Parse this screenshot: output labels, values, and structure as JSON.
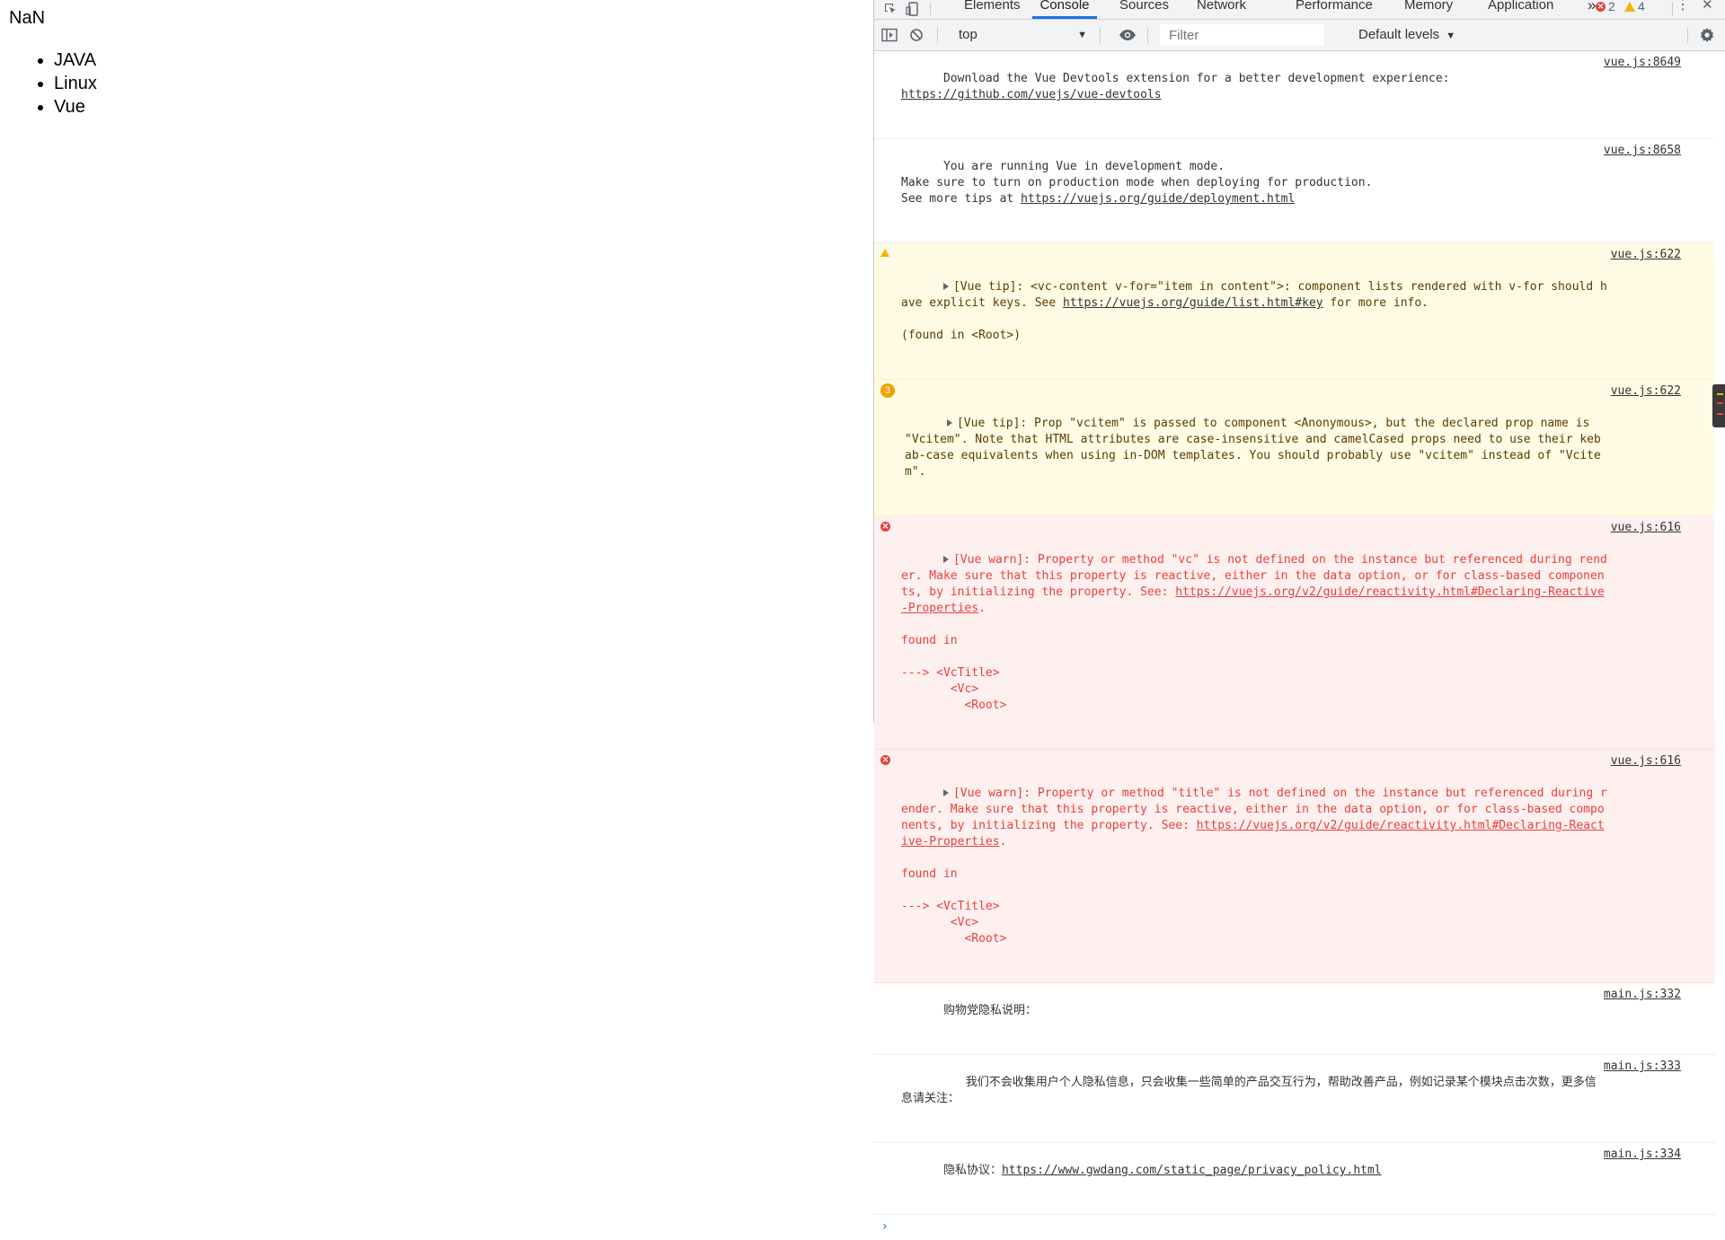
{
  "page": {
    "heading": "NaN",
    "items": [
      "JAVA",
      "Linux",
      "Vue"
    ]
  },
  "devtools": {
    "tabs": [
      "Elements",
      "Console",
      "Sources",
      "Network",
      "Performance",
      "Memory",
      "Application"
    ],
    "active_tab": "Console",
    "more_tabs": "»",
    "error_count": "2",
    "warning_count": "4",
    "menu_icon": "⋮",
    "close_icon": "✕",
    "toolbar": {
      "context": "top",
      "filter_placeholder": "Filter",
      "levels": "Default levels"
    },
    "messages": [
      {
        "level": "info",
        "text": "Download the Vue Devtools extension for a better development experience:\n",
        "link": "https://github.com/vuejs/vue-devtools",
        "source": "vue.js:8649"
      },
      {
        "level": "info",
        "text": "You are running Vue in development mode.\nMake sure to turn on production mode when deploying for production.\nSee more tips at ",
        "link": "https://vuejs.org/guide/deployment.html",
        "source": "vue.js:8658"
      },
      {
        "level": "warning",
        "text_before": "[Vue tip]: <vc-content v-for=\"item in content\">: component lists rendered with v-for should have explicit keys. See ",
        "link": "https://vuejs.org/guide/list.html#key",
        "text_after": " for more info.\n\n(found in <Root>)",
        "source": "vue.js:622"
      },
      {
        "level": "warning",
        "repeat_count": "3",
        "text": "[Vue tip]: Prop \"vcitem\" is passed to component <Anonymous>, but the declared prop name is \"Vcitem\". Note that HTML attributes are case-insensitive and camelCased props need to use their kebab-case equivalents when using in-DOM templates. You should probably use \"vcitem\" instead of \"Vcitem\".",
        "source": "vue.js:622"
      },
      {
        "level": "error",
        "text_before": "[Vue warn]: Property or method \"vc\" is not defined on the instance but referenced during render. Make sure that this property is reactive, either in the data option, or for class-based components, by initializing the property. See: ",
        "link": "https://vuejs.org/v2/guide/reactivity.html#Declaring-Reactive-Properties",
        "text_after": ".\n\nfound in\n\n---> <VcTitle>\n       <Vc>\n         <Root>",
        "source": "vue.js:616"
      },
      {
        "level": "error",
        "text_before": "[Vue warn]: Property or method \"title\" is not defined on the instance but referenced during render. Make sure that this property is reactive, either in the data option, or for class-based components, by initializing the property. See: ",
        "link": "https://vuejs.org/v2/guide/reactivity.html#Declaring-Reactive-Properties",
        "text_after": ".\n\nfound in\n\n---> <VcTitle>\n       <Vc>\n         <Root>",
        "source": "vue.js:616"
      },
      {
        "level": "info",
        "text": "购物党隐私说明：",
        "source": "main.js:332"
      },
      {
        "level": "info",
        "text": "      我们不会收集用户个人隐私信息，只会收集一些简单的产品交互行为，帮助改善产品，例如记录某个模块点击次数，更多信息请关注：",
        "source": "main.js:333"
      },
      {
        "level": "info",
        "text": "隐私协议：",
        "link": "https://www.gwdang.com/static_page/privacy_policy.html",
        "source": "main.js:334"
      }
    ],
    "prompt_symbol": "›"
  }
}
